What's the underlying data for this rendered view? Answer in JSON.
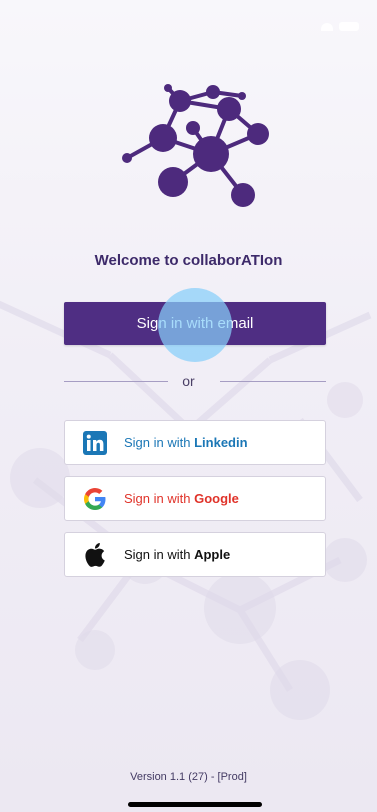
{
  "status_bar": {
    "icons": [
      "wifi-icon",
      "battery-icon"
    ]
  },
  "logo": {
    "icon": "network-icon",
    "color": "#4d2a7d"
  },
  "welcome": {
    "text": "Welcome to collaborATIon"
  },
  "primary": {
    "label": "Sign in with email",
    "color": "#4f2e83"
  },
  "divider": {
    "text": "or"
  },
  "social": {
    "linkedin": {
      "prefix": "Sign in with ",
      "brand": "Linkedin",
      "icon": "linkedin-icon",
      "color": "#1b77b6"
    },
    "google": {
      "prefix": "Sign in with ",
      "brand": "Google",
      "icon": "google-icon",
      "color": "#e0332a"
    },
    "apple": {
      "prefix": "Sign in with ",
      "brand": "Apple",
      "icon": "apple-icon",
      "color": "#111111"
    }
  },
  "footer": {
    "version": "Version 1.1 (27) - [Prod]"
  }
}
